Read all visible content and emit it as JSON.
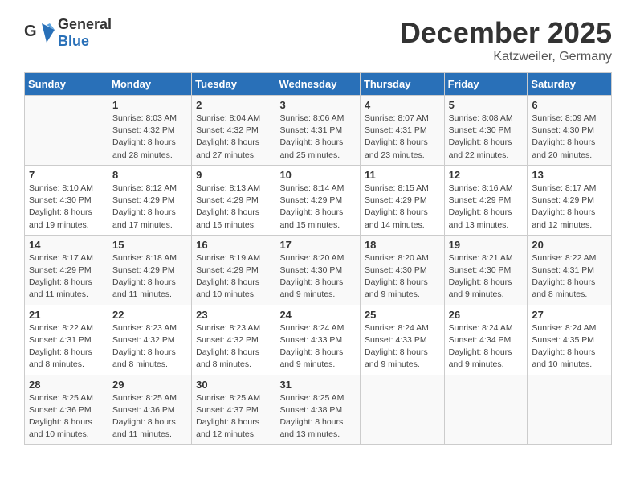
{
  "logo": {
    "general": "General",
    "blue": "Blue"
  },
  "header": {
    "month": "December 2025",
    "location": "Katzweiler, Germany"
  },
  "weekdays": [
    "Sunday",
    "Monday",
    "Tuesday",
    "Wednesday",
    "Thursday",
    "Friday",
    "Saturday"
  ],
  "weeks": [
    [
      {
        "day": "",
        "info": ""
      },
      {
        "day": "1",
        "info": "Sunrise: 8:03 AM\nSunset: 4:32 PM\nDaylight: 8 hours\nand 28 minutes."
      },
      {
        "day": "2",
        "info": "Sunrise: 8:04 AM\nSunset: 4:32 PM\nDaylight: 8 hours\nand 27 minutes."
      },
      {
        "day": "3",
        "info": "Sunrise: 8:06 AM\nSunset: 4:31 PM\nDaylight: 8 hours\nand 25 minutes."
      },
      {
        "day": "4",
        "info": "Sunrise: 8:07 AM\nSunset: 4:31 PM\nDaylight: 8 hours\nand 23 minutes."
      },
      {
        "day": "5",
        "info": "Sunrise: 8:08 AM\nSunset: 4:30 PM\nDaylight: 8 hours\nand 22 minutes."
      },
      {
        "day": "6",
        "info": "Sunrise: 8:09 AM\nSunset: 4:30 PM\nDaylight: 8 hours\nand 20 minutes."
      }
    ],
    [
      {
        "day": "7",
        "info": "Sunrise: 8:10 AM\nSunset: 4:30 PM\nDaylight: 8 hours\nand 19 minutes."
      },
      {
        "day": "8",
        "info": "Sunrise: 8:12 AM\nSunset: 4:29 PM\nDaylight: 8 hours\nand 17 minutes."
      },
      {
        "day": "9",
        "info": "Sunrise: 8:13 AM\nSunset: 4:29 PM\nDaylight: 8 hours\nand 16 minutes."
      },
      {
        "day": "10",
        "info": "Sunrise: 8:14 AM\nSunset: 4:29 PM\nDaylight: 8 hours\nand 15 minutes."
      },
      {
        "day": "11",
        "info": "Sunrise: 8:15 AM\nSunset: 4:29 PM\nDaylight: 8 hours\nand 14 minutes."
      },
      {
        "day": "12",
        "info": "Sunrise: 8:16 AM\nSunset: 4:29 PM\nDaylight: 8 hours\nand 13 minutes."
      },
      {
        "day": "13",
        "info": "Sunrise: 8:17 AM\nSunset: 4:29 PM\nDaylight: 8 hours\nand 12 minutes."
      }
    ],
    [
      {
        "day": "14",
        "info": "Sunrise: 8:17 AM\nSunset: 4:29 PM\nDaylight: 8 hours\nand 11 minutes."
      },
      {
        "day": "15",
        "info": "Sunrise: 8:18 AM\nSunset: 4:29 PM\nDaylight: 8 hours\nand 11 minutes."
      },
      {
        "day": "16",
        "info": "Sunrise: 8:19 AM\nSunset: 4:29 PM\nDaylight: 8 hours\nand 10 minutes."
      },
      {
        "day": "17",
        "info": "Sunrise: 8:20 AM\nSunset: 4:30 PM\nDaylight: 8 hours\nand 9 minutes."
      },
      {
        "day": "18",
        "info": "Sunrise: 8:20 AM\nSunset: 4:30 PM\nDaylight: 8 hours\nand 9 minutes."
      },
      {
        "day": "19",
        "info": "Sunrise: 8:21 AM\nSunset: 4:30 PM\nDaylight: 8 hours\nand 9 minutes."
      },
      {
        "day": "20",
        "info": "Sunrise: 8:22 AM\nSunset: 4:31 PM\nDaylight: 8 hours\nand 8 minutes."
      }
    ],
    [
      {
        "day": "21",
        "info": "Sunrise: 8:22 AM\nSunset: 4:31 PM\nDaylight: 8 hours\nand 8 minutes."
      },
      {
        "day": "22",
        "info": "Sunrise: 8:23 AM\nSunset: 4:32 PM\nDaylight: 8 hours\nand 8 minutes."
      },
      {
        "day": "23",
        "info": "Sunrise: 8:23 AM\nSunset: 4:32 PM\nDaylight: 8 hours\nand 8 minutes."
      },
      {
        "day": "24",
        "info": "Sunrise: 8:24 AM\nSunset: 4:33 PM\nDaylight: 8 hours\nand 9 minutes."
      },
      {
        "day": "25",
        "info": "Sunrise: 8:24 AM\nSunset: 4:33 PM\nDaylight: 8 hours\nand 9 minutes."
      },
      {
        "day": "26",
        "info": "Sunrise: 8:24 AM\nSunset: 4:34 PM\nDaylight: 8 hours\nand 9 minutes."
      },
      {
        "day": "27",
        "info": "Sunrise: 8:24 AM\nSunset: 4:35 PM\nDaylight: 8 hours\nand 10 minutes."
      }
    ],
    [
      {
        "day": "28",
        "info": "Sunrise: 8:25 AM\nSunset: 4:36 PM\nDaylight: 8 hours\nand 10 minutes."
      },
      {
        "day": "29",
        "info": "Sunrise: 8:25 AM\nSunset: 4:36 PM\nDaylight: 8 hours\nand 11 minutes."
      },
      {
        "day": "30",
        "info": "Sunrise: 8:25 AM\nSunset: 4:37 PM\nDaylight: 8 hours\nand 12 minutes."
      },
      {
        "day": "31",
        "info": "Sunrise: 8:25 AM\nSunset: 4:38 PM\nDaylight: 8 hours\nand 13 minutes."
      },
      {
        "day": "",
        "info": ""
      },
      {
        "day": "",
        "info": ""
      },
      {
        "day": "",
        "info": ""
      }
    ]
  ]
}
